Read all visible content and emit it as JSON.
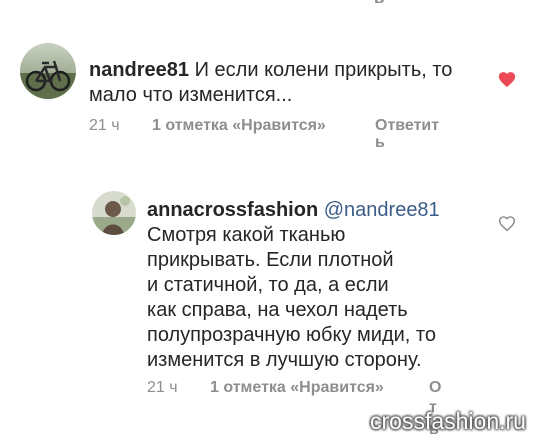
{
  "top_cut_char": "ь",
  "comments": [
    {
      "username": "nandree81",
      "text_line1": "И если колени прикрыть, то",
      "text_line2": "мало что изменится...",
      "time": "21 ч",
      "likes": "1 отметка «Нравится»",
      "reply_line1": "Ответит",
      "reply_line2": "ь",
      "liked": true,
      "avatar_icon": "bicycle-photo"
    },
    {
      "username": "annacrossfashion",
      "mention": "@nandree81",
      "lines": [
        "Смотря какой тканью",
        "прикрывать. Если плотной",
        "и статичной, то да, а если",
        "как справа, на чехол надеть",
        "полупрозрачную юбку миди, то",
        "изменится в лучшую сторону."
      ],
      "time": "21 ч",
      "likes": "1 отметка «Нравится»",
      "reply_line1": "О",
      "reply_line2": "т",
      "reply_line3": "в",
      "liked": false,
      "avatar_icon": "profile-photo"
    }
  ],
  "colors": {
    "heart_liked": "#ed4956",
    "heart_outline": "#8e8e8e",
    "meta_text": "#8e8e8e",
    "mention": "#3b5d8a"
  },
  "watermark": "crossfashion.ru"
}
